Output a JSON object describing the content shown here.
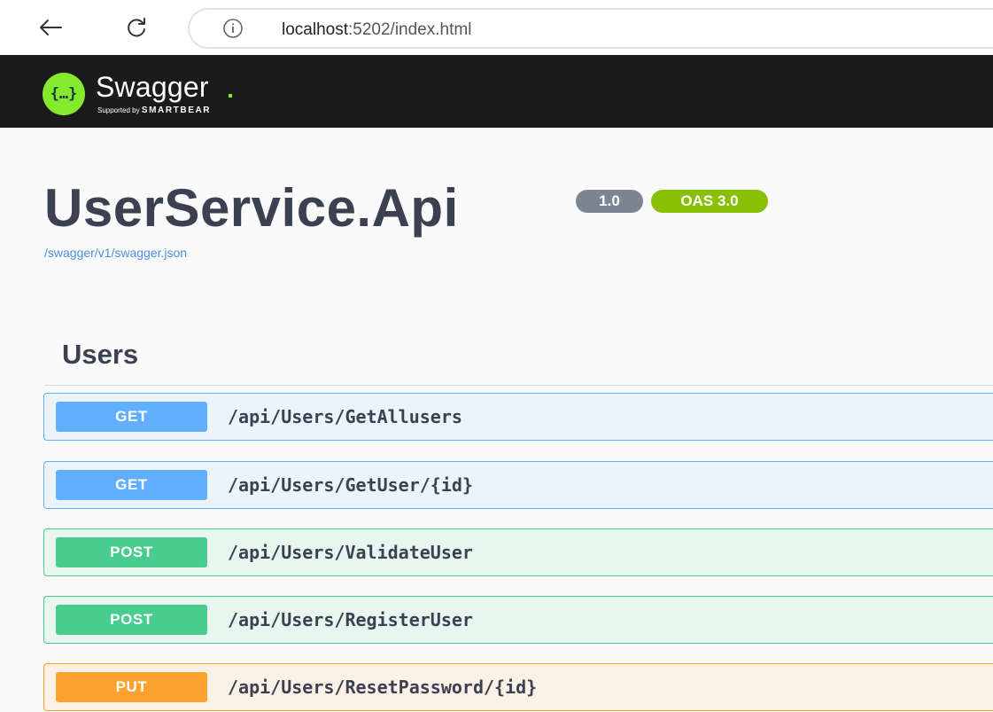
{
  "browser": {
    "url_host": "localhost",
    "url_rest": ":5202/index.html",
    "icons": {
      "back": "arrow-left-icon",
      "refresh": "refresh-icon",
      "info": "info-icon"
    }
  },
  "topbar": {
    "logo_symbol": "{…}",
    "logo_name": "Swagger",
    "logo_supported_by": "Supported by",
    "logo_company": "SMARTBEAR"
  },
  "info": {
    "title": "UserService.Api",
    "version": "1.0",
    "oas": "OAS 3.0",
    "spec_url": "/swagger/v1/swagger.json"
  },
  "tag": {
    "name": "Users"
  },
  "operations": [
    {
      "method": "GET",
      "path": "/api/Users/GetAllusers"
    },
    {
      "method": "GET",
      "path": "/api/Users/GetUser/{id}"
    },
    {
      "method": "POST",
      "path": "/api/Users/ValidateUser"
    },
    {
      "method": "POST",
      "path": "/api/Users/RegisterUser"
    },
    {
      "method": "PUT",
      "path": "/api/Users/ResetPassword/{id}"
    }
  ],
  "colors": {
    "get": "#61affe",
    "post": "#49cc90",
    "put": "#fca130",
    "topbar": "#1b1b1b",
    "logo": "#85ea2d",
    "version_badge": "#7d8492",
    "oas_badge": "#89bf04"
  }
}
